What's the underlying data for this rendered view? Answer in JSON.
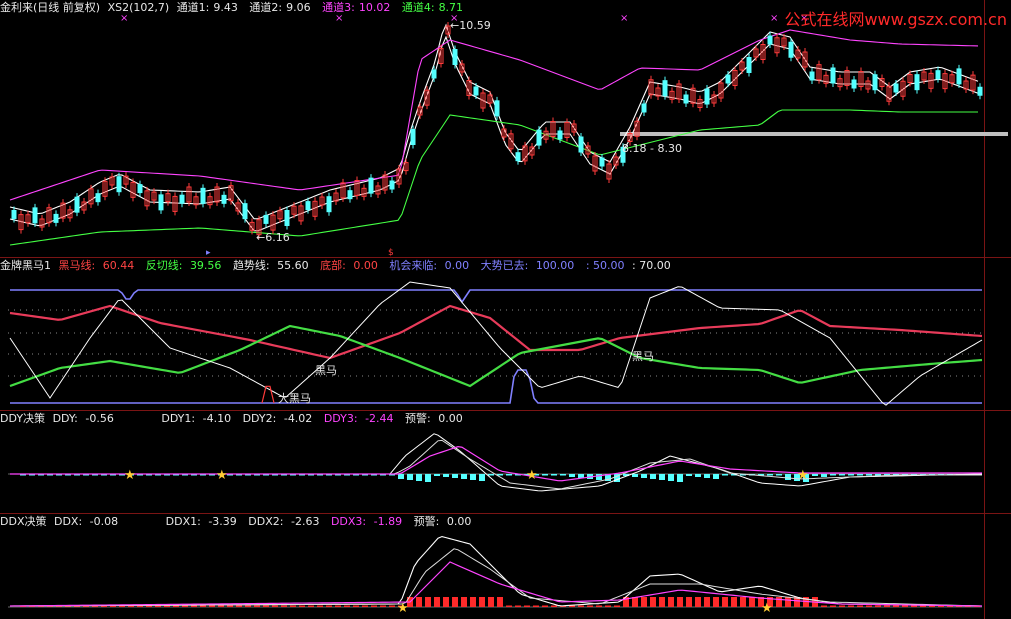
{
  "watermark": "公式在线网www.gszx.com.cn",
  "panel1": {
    "title": "金利来(日线 前复权)",
    "name": "XS2(102,7)",
    "ch1_label": "通道1:",
    "ch1_value": "9.43",
    "ch2_label": "通道2:",
    "ch2_value": "9.06",
    "ch3_label": "通道3:",
    "ch3_value": "10.02",
    "ch4_label": "通道4:",
    "ch4_value": "8.71",
    "high_label": "10.59",
    "low_label": "6.16",
    "range_label": "8.18 - 8.30",
    "markers": [
      "×",
      "×",
      "×",
      "×",
      "×",
      "×"
    ]
  },
  "panel2": {
    "title": "金牌黑马1",
    "dark_label": "黑马线:",
    "dark_value": "60.44",
    "fq_label": "反切线:",
    "fq_value": "39.56",
    "trend_label": "趋势线:",
    "trend_value": "55.60",
    "bottom_label": "底部:",
    "bottom_value": "0.00",
    "chance_label": "机会来临:",
    "chance_value": "0.00",
    "gone_label": "大势已去:",
    "gone_value": "100.00",
    "v5": ": 50.00",
    "v6": ": 70.00",
    "annot1": "黑马",
    "annot2": "黑马",
    "annot3": "大黑马"
  },
  "panel3": {
    "title": "DDY决策",
    "ddy_label": "DDY:",
    "ddy_value": "-0.56",
    "ddy1_label": "DDY1:",
    "ddy1_value": "-4.10",
    "ddy2_label": "DDY2:",
    "ddy2_value": "-4.02",
    "ddy3_label": "DDY3:",
    "ddy3_value": "-2.44",
    "warn_label": "预警:",
    "warn_value": "0.00"
  },
  "panel4": {
    "title": "DDX决策",
    "ddx_label": "DDX:",
    "ddx_value": "-0.08",
    "ddx1_label": "DDX1:",
    "ddx1_value": "-3.39",
    "ddx2_label": "DDX2:",
    "ddx2_value": "-2.63",
    "ddx3_label": "DDX3:",
    "ddx3_value": "-1.89",
    "warn_label": "预警:",
    "warn_value": "0.00"
  },
  "colors": {
    "up": "#ff3b3b",
    "down": "#55ffff",
    "ma": "#ffffff",
    "ch_top": "#ff44ff",
    "ch_bot": "#44ff44",
    "grid": "#7a1414"
  }
}
